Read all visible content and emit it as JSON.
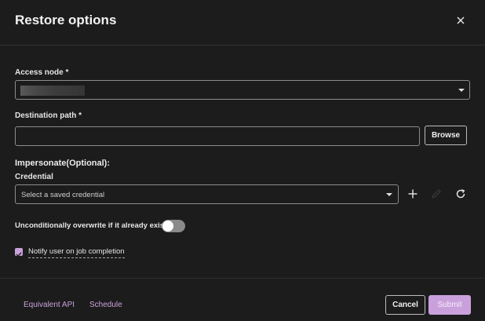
{
  "dialog": {
    "title": "Restore options",
    "close_icon": "close-icon"
  },
  "access_node": {
    "label": "Access node",
    "required_mark": "*",
    "value_masked": true
  },
  "destination_path": {
    "label": "Destination path",
    "required_mark": "*",
    "value": "",
    "placeholder": "",
    "browse_label": "Browse"
  },
  "impersonate": {
    "title": "Impersonate(Optional):",
    "credential_label": "Credential",
    "credential_placeholder": "Select a saved credential",
    "icons": [
      "plus-icon",
      "pencil-icon",
      "refresh-icon"
    ]
  },
  "overwrite": {
    "label": "Unconditionally overwrite if it already exists",
    "enabled": false
  },
  "notify": {
    "label": "Notify user on job completion",
    "checked": true
  },
  "footer": {
    "equivalent_api": "Equivalent API",
    "schedule": "Schedule",
    "cancel": "Cancel",
    "submit": "Submit"
  },
  "colors": {
    "accent": "#c9a0dc",
    "background": "#1c1c1c"
  }
}
